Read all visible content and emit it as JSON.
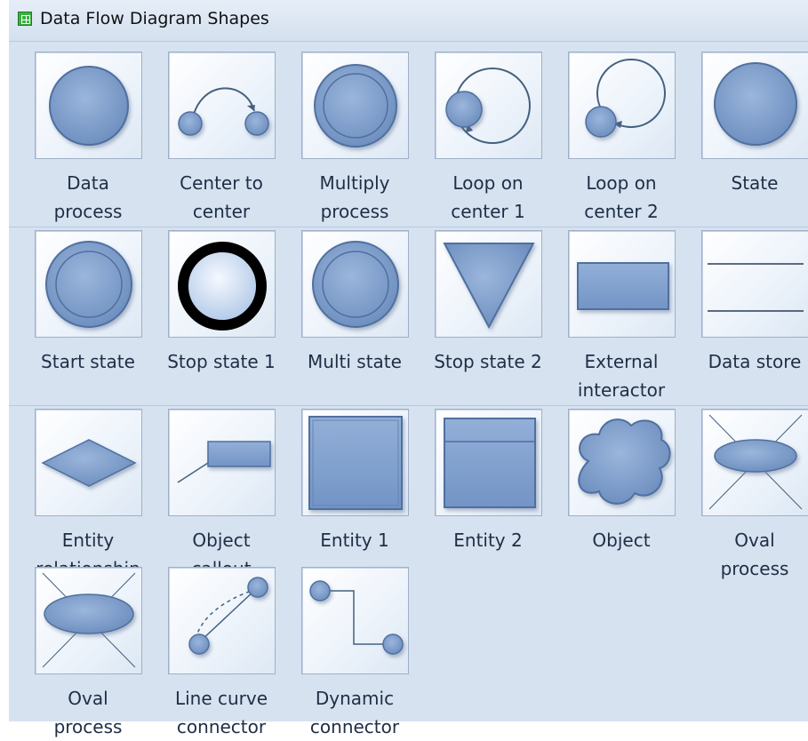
{
  "panel": {
    "title": "Data Flow Diagram Shapes",
    "icon": "stencil-grid-icon"
  },
  "colors": {
    "shape_fill": "#7f9fcc",
    "shape_stroke": "#4f6f9f",
    "tile_bg": "#eef4fb",
    "panel_bg": "#d6e2f0"
  },
  "shapes": [
    {
      "label": "Data\nprocess",
      "icon": "data-process-icon"
    },
    {
      "label": "Center to\ncenter",
      "icon": "center-to-center-icon"
    },
    {
      "label": "Multiply\nprocess",
      "icon": "multiply-process-icon"
    },
    {
      "label": "Loop on\ncenter 1",
      "icon": "loop-on-center-1-icon"
    },
    {
      "label": "Loop on\ncenter 2",
      "icon": "loop-on-center-2-icon"
    },
    {
      "label": "State",
      "icon": "state-icon"
    },
    {
      "label": "Start state",
      "icon": "start-state-icon"
    },
    {
      "label": "Stop state 1",
      "icon": "stop-state-1-icon"
    },
    {
      "label": "Multi state",
      "icon": "multi-state-icon"
    },
    {
      "label": "Stop state 2",
      "icon": "stop-state-2-icon"
    },
    {
      "label": "External\ninteractor",
      "icon": "external-interactor-icon"
    },
    {
      "label": "Data store",
      "icon": "data-store-icon"
    },
    {
      "label": "Entity\nrelationship",
      "icon": "entity-relationship-icon"
    },
    {
      "label": "Object\ncallout",
      "icon": "object-callout-icon"
    },
    {
      "label": "Entity 1",
      "icon": "entity-1-icon"
    },
    {
      "label": "Entity 2",
      "icon": "entity-2-icon"
    },
    {
      "label": "Object",
      "icon": "object-icon"
    },
    {
      "label": "Oval\nprocess",
      "icon": "oval-process-icon"
    },
    {
      "label": "Oval\nprocess",
      "icon": "oval-process-icon"
    },
    {
      "label": "Line curve\nconnector",
      "icon": "line-curve-connector-icon"
    },
    {
      "label": "Dynamic\nconnector",
      "icon": "dynamic-connector-icon"
    }
  ]
}
